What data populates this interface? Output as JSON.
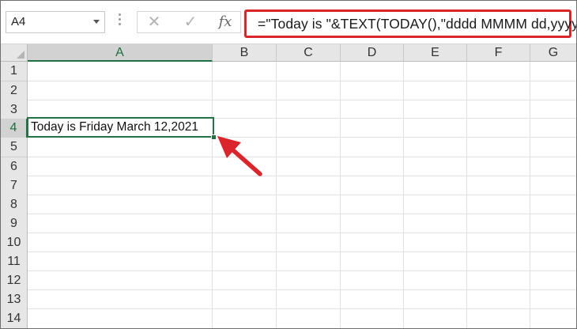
{
  "name_box": {
    "value": "A4"
  },
  "formula_bar": {
    "cancel_icon": "cancel-x-icon",
    "enter_icon": "checkmark-icon",
    "fx_label": "fx",
    "formula": "=\"Today is \"&TEXT(TODAY(),\"dddd MMMM dd,yyyy\")"
  },
  "columns": [
    "A",
    "B",
    "C",
    "D",
    "E",
    "F",
    "G"
  ],
  "rows": [
    "1",
    "2",
    "3",
    "4",
    "5",
    "6",
    "7",
    "8",
    "9",
    "10",
    "11",
    "12",
    "13",
    "14"
  ],
  "active_cell": {
    "ref": "A4",
    "value": "Today is Friday March 12,2021"
  },
  "colors": {
    "excel_green": "#217346",
    "annotation_red": "#d9252b"
  }
}
